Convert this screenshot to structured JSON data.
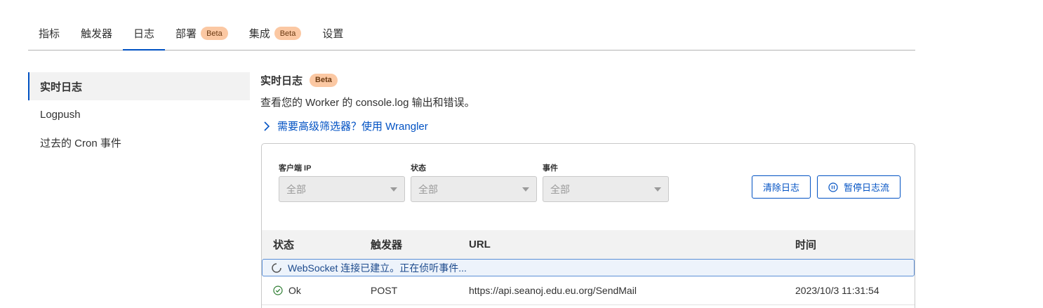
{
  "tabs": [
    {
      "label": "指标"
    },
    {
      "label": "触发器"
    },
    {
      "label": "日志",
      "active": true
    },
    {
      "label": "部署",
      "badge": "Beta"
    },
    {
      "label": "集成",
      "badge": "Beta"
    },
    {
      "label": "设置"
    }
  ],
  "sidebar": {
    "items": [
      {
        "label": "实时日志",
        "active": true
      },
      {
        "label": "Logpush"
      },
      {
        "label": "过去的 Cron 事件"
      }
    ]
  },
  "main": {
    "title": "实时日志",
    "title_badge": "Beta",
    "description": "查看您的 Worker 的 console.log 输出和错误。",
    "advanced_link": "需要高级筛选器？使用 Wrangler"
  },
  "filters": {
    "client_ip": {
      "label": "客户端 IP",
      "value": "全部"
    },
    "status": {
      "label": "状态",
      "value": "全部"
    },
    "event": {
      "label": "事件",
      "value": "全部"
    }
  },
  "buttons": {
    "clear_logs": "清除日志",
    "pause_stream": "暂停日志流"
  },
  "table": {
    "headers": {
      "status": "状态",
      "trigger": "触发器",
      "url": "URL",
      "time": "时间"
    },
    "websocket_message": "WebSocket 连接已建立。正在侦听事件...",
    "rows": [
      {
        "status": "Ok",
        "trigger": "POST",
        "url": "https://api.seanoj.edu.eu.org/SendMail",
        "time": "2023/10/3 11:31:54"
      }
    ]
  },
  "colors": {
    "accent": "#0051c3",
    "beta_badge": "#fbc8a3",
    "ok_green": "#2e7d32"
  }
}
